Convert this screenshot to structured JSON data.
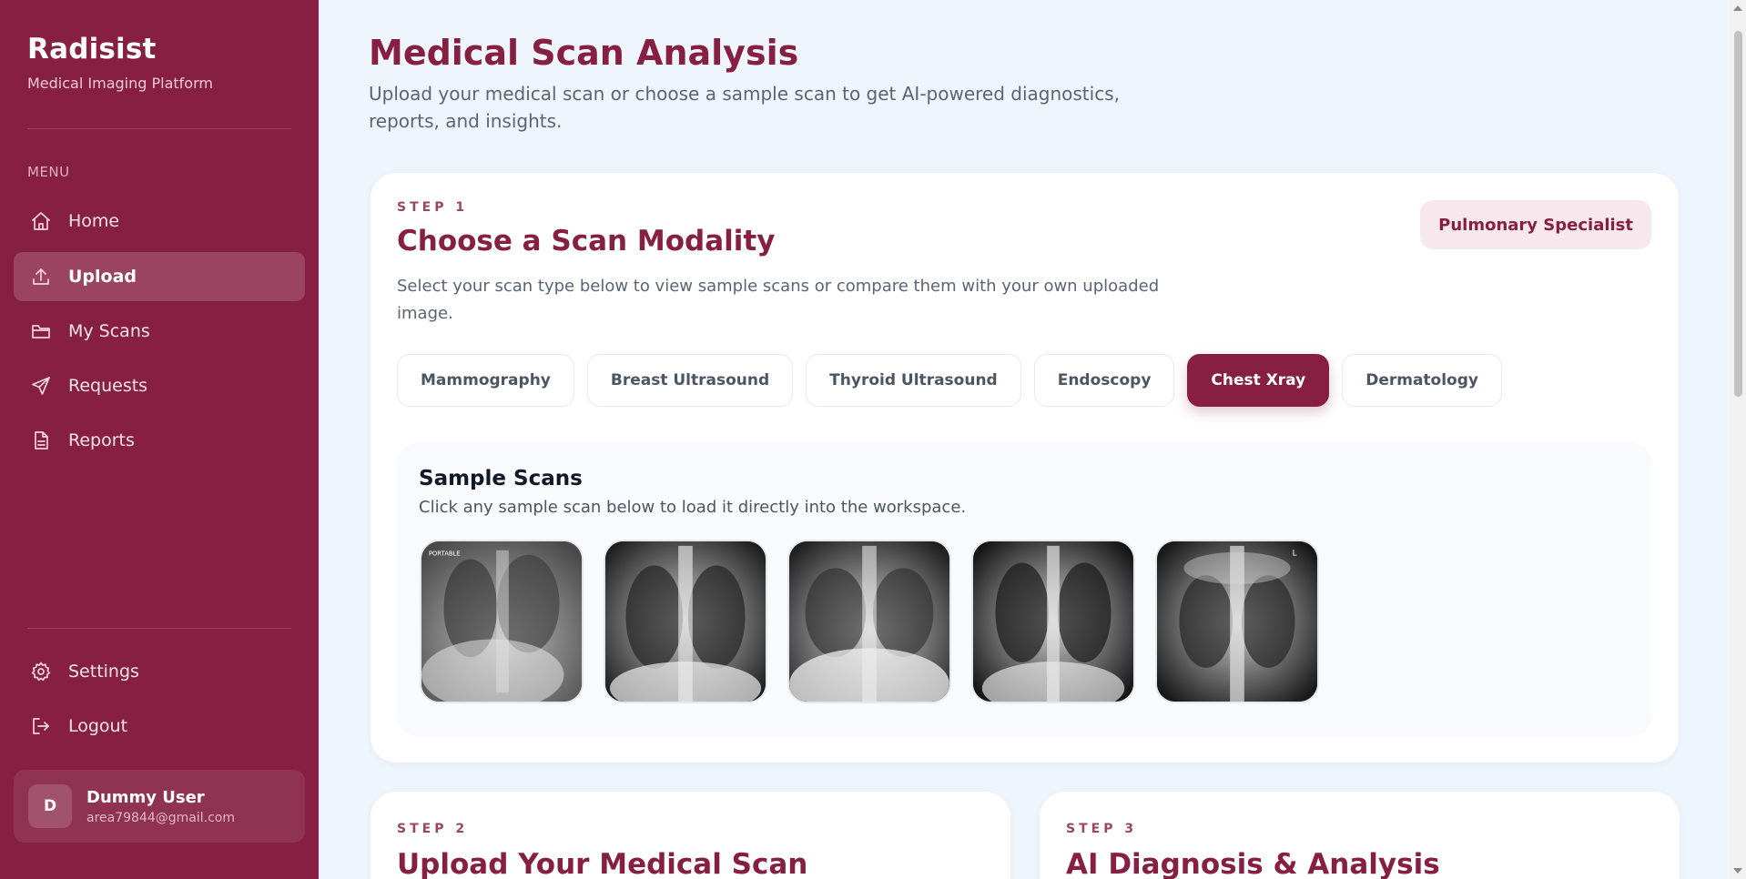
{
  "sidebar": {
    "brand": "Radisist",
    "tagline": "Medical Imaging Platform",
    "menu_label": "MENU",
    "items": [
      {
        "label": "Home",
        "icon": "home-icon"
      },
      {
        "label": "Upload",
        "icon": "upload-icon",
        "active": true
      },
      {
        "label": "My Scans",
        "icon": "folder-icon"
      },
      {
        "label": "Requests",
        "icon": "send-icon"
      },
      {
        "label": "Reports",
        "icon": "document-icon"
      }
    ],
    "bottom_items": [
      {
        "label": "Settings",
        "icon": "gear-icon"
      },
      {
        "label": "Logout",
        "icon": "logout-icon"
      }
    ],
    "user": {
      "initial": "D",
      "name": "Dummy User",
      "email": "area79844@gmail.com"
    }
  },
  "main": {
    "title": "Medical Scan Analysis",
    "subtitle": "Upload your medical scan or choose a sample scan to get AI-powered diagnostics, reports, and insights.",
    "step1": {
      "label": "STEP 1",
      "title": "Choose a Scan Modality",
      "description": "Select your scan type below to view sample scans or compare them with your own uploaded image.",
      "specialist": "Pulmonary Specialist",
      "tabs": [
        "Mammography",
        "Breast Ultrasound",
        "Thyroid Ultrasound",
        "Endoscopy",
        "Chest Xray",
        "Dermatology"
      ],
      "active_tab": "Chest Xray",
      "samples": {
        "title": "Sample Scans",
        "description": "Click any sample scan below to load it directly into the workspace.",
        "thumb_labels": [
          "PORTABLE",
          "",
          "",
          "",
          "L"
        ]
      }
    },
    "step2": {
      "label": "STEP 2",
      "title": "Upload Your Medical Scan"
    },
    "step3": {
      "label": "STEP 3",
      "title": "AI Diagnosis & Analysis"
    }
  },
  "colors": {
    "brand": "#861f42",
    "background": "#eef5fd",
    "card": "#ffffff",
    "specialist_badge": "#f7e8ee"
  }
}
